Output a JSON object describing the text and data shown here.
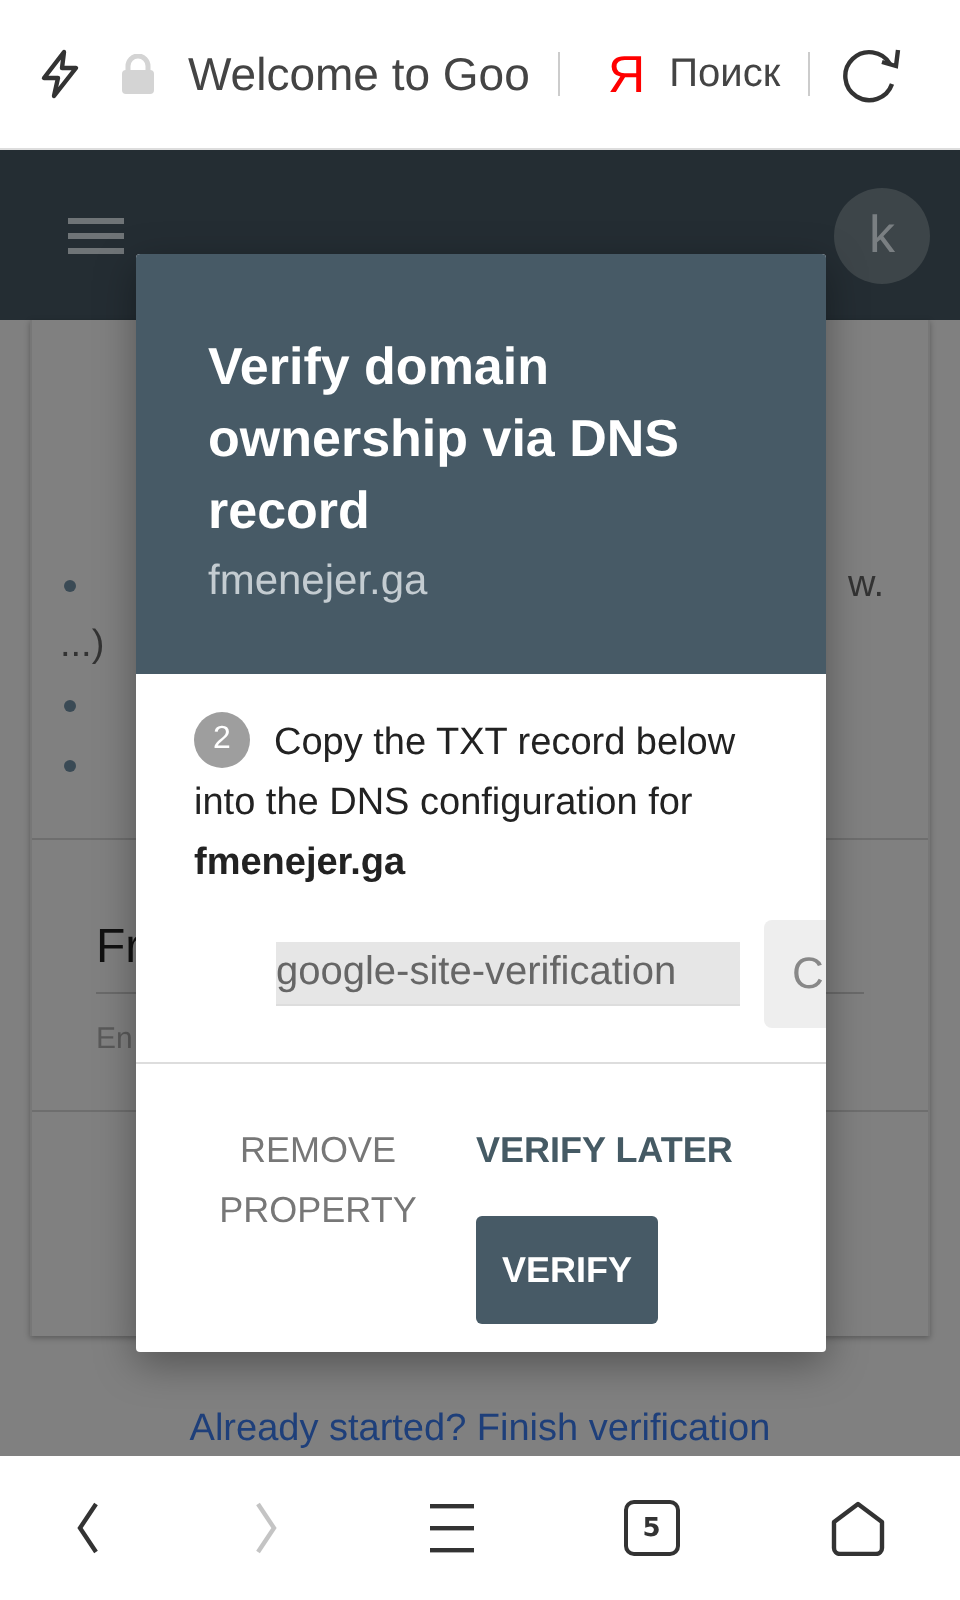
{
  "browser_bar": {
    "title": "Welcome to Goo",
    "search_logo": "Я",
    "search_label": "Поиск"
  },
  "app_bar": {
    "avatar": "k"
  },
  "page": {
    "list_items": [
      {
        "kind": "cut",
        "tail": "w.",
        "wrap": "...)"
      },
      {
        "kind": "hidden"
      },
      {
        "kind": "hidden"
      }
    ],
    "form_field": {
      "label": "Fr",
      "hint": "En"
    },
    "link": "Already started? Finish verification"
  },
  "dialog": {
    "title": "Verify domain ownership via DNS record",
    "subtitle": "fmenejer.ga",
    "step": {
      "number": "2",
      "text": "Copy the TXT record below into the DNS configuration for **fmenejer.ga**"
    },
    "record_field": {
      "value": "google-site-verification"
    },
    "copy_button": "C",
    "buttons": [
      {
        "kind": "text",
        "label": "REMOVE PROPERTY"
      },
      {
        "kind": "accent",
        "label": "VERIFY LATER"
      },
      {
        "kind": "primary",
        "label": "VERIFY"
      }
    ]
  },
  "nav": [
    {
      "kind": "back",
      "disabled": false
    },
    {
      "kind": "forward",
      "disabled": true
    },
    {
      "kind": "menu",
      "disabled": false
    },
    {
      "kind": "tabs",
      "count": "5",
      "disabled": false
    },
    {
      "kind": "home",
      "disabled": false
    }
  ]
}
